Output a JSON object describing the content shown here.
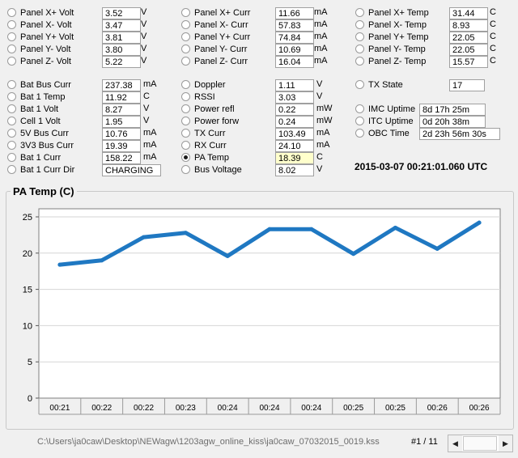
{
  "telemetry": [
    {
      "label": "Panel X+ Volt",
      "value": "3.52",
      "unit": "V"
    },
    {
      "label": "Panel X- Volt",
      "value": "3.47",
      "unit": "V"
    },
    {
      "label": "Panel Y+ Volt",
      "value": "3.81",
      "unit": "V"
    },
    {
      "label": "Panel Y- Volt",
      "value": "3.80",
      "unit": "V"
    },
    {
      "label": "Panel Z- Volt",
      "value": "5.22",
      "unit": "V"
    },
    {
      "label": "Panel X+ Curr",
      "value": "11.66",
      "unit": "mA"
    },
    {
      "label": "Panel X- Curr",
      "value": "57.83",
      "unit": "mA"
    },
    {
      "label": "Panel Y+ Curr",
      "value": "74.84",
      "unit": "mA"
    },
    {
      "label": "Panel Y- Curr",
      "value": "10.69",
      "unit": "mA"
    },
    {
      "label": "Panel Z- Curr",
      "value": "16.04",
      "unit": "mA"
    },
    {
      "label": "Panel X+ Temp",
      "value": "31.44",
      "unit": "C"
    },
    {
      "label": "Panel X- Temp",
      "value": "8.93",
      "unit": "C"
    },
    {
      "label": "Panel Y+ Temp",
      "value": "22.05",
      "unit": "C"
    },
    {
      "label": "Panel Y- Temp",
      "value": "22.05",
      "unit": "C"
    },
    {
      "label": "Panel Z- Temp",
      "value": "15.57",
      "unit": "C"
    },
    {
      "label": "Bat Bus Curr",
      "value": "237.38",
      "unit": "mA"
    },
    {
      "label": "Bat 1 Temp",
      "value": "11.92",
      "unit": "C"
    },
    {
      "label": "Bat 1 Volt",
      "value": "8.27",
      "unit": "V"
    },
    {
      "label": "Cell 1 Volt",
      "value": "1.95",
      "unit": "V"
    },
    {
      "label": "5V Bus Curr",
      "value": "10.76",
      "unit": "mA"
    },
    {
      "label": "3V3 Bus Curr",
      "value": "19.39",
      "unit": "mA"
    },
    {
      "label": "Bat 1 Curr",
      "value": "158.22",
      "unit": "mA"
    },
    {
      "label": "Bat 1 Curr Dir",
      "value": "CHARGING",
      "unit": ""
    },
    {
      "label": "Doppler",
      "value": "1.11",
      "unit": "V"
    },
    {
      "label": "RSSI",
      "value": "3.03",
      "unit": "V"
    },
    {
      "label": "Power refl",
      "value": "0.22",
      "unit": "mW"
    },
    {
      "label": "Power forw",
      "value": "0.24",
      "unit": "mW"
    },
    {
      "label": "TX Curr",
      "value": "103.49",
      "unit": "mA"
    },
    {
      "label": "RX Curr",
      "value": "24.10",
      "unit": "mA"
    },
    {
      "label": "PA Temp",
      "value": "18.39",
      "unit": "C",
      "selected": true
    },
    {
      "label": "Bus Voltage",
      "value": "8.02",
      "unit": "V"
    },
    {
      "label": "TX State",
      "value": "17",
      "unit": ""
    },
    {
      "label": "IMC Uptime",
      "value": "8d 17h 25m",
      "unit": ""
    },
    {
      "label": "ITC Uptime",
      "value": "0d 20h 38m",
      "unit": ""
    },
    {
      "label": "OBC Time",
      "value": "2d 23h 56m 30s",
      "unit": ""
    }
  ],
  "timestamp": "2015-03-07 00:21:01.060 UTC",
  "chart_group_title": "PA Temp (C)",
  "chart_data": {
    "type": "line",
    "title": "PA Temp (C)",
    "categories": [
      "00:21",
      "00:22",
      "00:22",
      "00:23",
      "00:24",
      "00:24",
      "00:24",
      "00:25",
      "00:25",
      "00:26",
      "00:26"
    ],
    "series": [
      {
        "values": [
          18.4,
          19.0,
          22.2,
          22.8,
          19.6,
          23.3,
          23.3,
          19.9,
          23.5,
          20.6,
          24.2
        ]
      }
    ],
    "ylim": [
      0,
      25
    ],
    "yticks": [
      0,
      5,
      10,
      15,
      20,
      25
    ],
    "grid": true,
    "line_color": "#1f78c2"
  },
  "status": {
    "file_path": "C:\\Users\\ja0caw\\Desktop\\NEWagw\\1203agw_online_kiss\\ja0caw_07032015_0019.kss",
    "page": "#1 / 11"
  },
  "scrollbar": {
    "left_icon": "left-arrow-icon",
    "right_icon": "right-arrow-icon"
  }
}
